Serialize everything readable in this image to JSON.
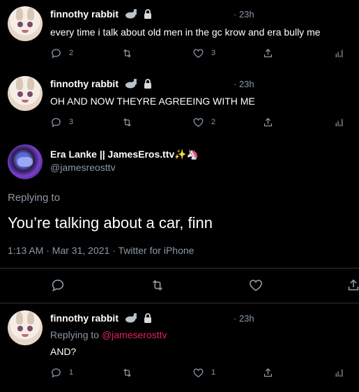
{
  "tweets": [
    {
      "author": "finnothy rabbit",
      "time": "· 23h",
      "text": "every time i talk about old men in the gc krow and era bully me",
      "replies": "2",
      "likes": "3"
    },
    {
      "author": "finnothy rabbit",
      "time": "· 23h",
      "text": "OH AND NOW THEYRE AGREEING WITH ME",
      "replies": "3",
      "likes": "2"
    }
  ],
  "main_tweet": {
    "author": "Era Lanke || JamesEros.ttv",
    "emoji": "✨🦄",
    "handle": "@jamesreosttv",
    "replying_to": "Replying to",
    "text": "You’re talking about a car, finn",
    "meta": "1:13 AM · Mar 31, 2021 · Twitter for iPhone"
  },
  "reply": {
    "author": "finnothy rabbit",
    "time": "· 23h",
    "replying_prefix": "Replying to ",
    "replying_handle": "@jameserosttv",
    "text": "AND?",
    "replies": "1",
    "likes": "1"
  },
  "colors": {
    "background": "#000000",
    "secondary_text": "#8b98a5",
    "mention": "#e0245e",
    "divider": "#2f3336"
  },
  "icons": [
    "reply-icon",
    "retweet-icon",
    "like-icon",
    "share-icon",
    "analytics-icon",
    "rabbit-icon",
    "lock-icon"
  ]
}
